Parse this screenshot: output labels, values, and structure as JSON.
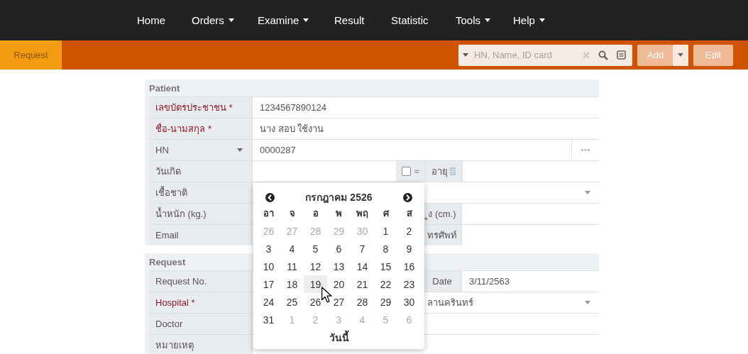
{
  "navbar": {
    "items": [
      {
        "label": "Home",
        "dropdown": false
      },
      {
        "label": "Orders",
        "dropdown": true
      },
      {
        "label": "Examine",
        "dropdown": true
      },
      {
        "label": "Result",
        "dropdown": false
      },
      {
        "label": "Statistic",
        "dropdown": false
      },
      {
        "label": "Tools",
        "dropdown": true
      },
      {
        "label": "Help",
        "dropdown": true
      }
    ]
  },
  "toolbar": {
    "tab": {
      "label": "Request",
      "selected": true
    },
    "search": {
      "placeholder": "HN, Name, ID card"
    },
    "buttons": [
      {
        "label": "Add",
        "split": true
      },
      {
        "label": "Edit",
        "split": false
      }
    ]
  },
  "sections": [
    {
      "title": "Patient",
      "rows": [
        {
          "kind": "text",
          "label": "เลขบัตรประชาชน *",
          "required": true,
          "value": "1234567890124"
        },
        {
          "kind": "text",
          "label": "ชื่อ-นามสกุล *",
          "required": true,
          "value": "นาง สอบ ใช้งาน"
        },
        {
          "kind": "select_label",
          "label": "HN",
          "required": false,
          "value": "0000287"
        },
        {
          "kind": "birth",
          "label": "วันเกิด",
          "required": false,
          "checked": false,
          "approx": "≈",
          "side_label": "อายุ"
        },
        {
          "kind": "select",
          "label": "เชื้อชาติ",
          "required": false
        },
        {
          "kind": "pair",
          "label": "น้ำหนัก (kg.)",
          "required": false,
          "side_label": "ูง (cm.)"
        },
        {
          "kind": "pair",
          "label": "Email",
          "required": false,
          "side_label": "ทรศัพท์"
        }
      ]
    },
    {
      "title": "Request",
      "rows": [
        {
          "kind": "date_pair",
          "label": "Request No.",
          "required": false,
          "side_label": "Date",
          "side_value": "3/11/2563"
        },
        {
          "kind": "select",
          "label": "Hospital *",
          "required": true,
          "value": "ลานครินทร์"
        },
        {
          "kind": "text",
          "label": "Doctor",
          "required": false
        },
        {
          "kind": "text",
          "label": "หมายเหตุ",
          "required": false
        }
      ]
    }
  ],
  "datepicker": {
    "title": "กรกฎาคม 2526",
    "weekdays": [
      "อา",
      "จ",
      "อ",
      "พ",
      "พฤ",
      "ศ",
      "ส"
    ],
    "weeks": [
      [
        {
          "day": "26",
          "other_month": true,
          "highlighted": false
        },
        {
          "day": "27",
          "other_month": true,
          "highlighted": false
        },
        {
          "day": "28",
          "other_month": true,
          "highlighted": false
        },
        {
          "day": "29",
          "other_month": true,
          "highlighted": false
        },
        {
          "day": "30",
          "other_month": true,
          "highlighted": false
        },
        {
          "day": "1",
          "other_month": false,
          "highlighted": false
        },
        {
          "day": "2",
          "other_month": false,
          "highlighted": false
        }
      ],
      [
        {
          "day": "3",
          "other_month": false,
          "highlighted": false
        },
        {
          "day": "4",
          "other_month": false,
          "highlighted": false
        },
        {
          "day": "5",
          "other_month": false,
          "highlighted": false
        },
        {
          "day": "6",
          "other_month": false,
          "highlighted": false
        },
        {
          "day": "7",
          "other_month": false,
          "highlighted": false
        },
        {
          "day": "8",
          "other_month": false,
          "highlighted": false
        },
        {
          "day": "9",
          "other_month": false,
          "highlighted": false
        }
      ],
      [
        {
          "day": "10",
          "other_month": false,
          "highlighted": false
        },
        {
          "day": "11",
          "other_month": false,
          "highlighted": false
        },
        {
          "day": "12",
          "other_month": false,
          "highlighted": false
        },
        {
          "day": "13",
          "other_month": false,
          "highlighted": false
        },
        {
          "day": "14",
          "other_month": false,
          "highlighted": false
        },
        {
          "day": "15",
          "other_month": false,
          "highlighted": false
        },
        {
          "day": "16",
          "other_month": false,
          "highlighted": false
        }
      ],
      [
        {
          "day": "17",
          "other_month": false,
          "highlighted": false
        },
        {
          "day": "18",
          "other_month": false,
          "highlighted": false
        },
        {
          "day": "19",
          "other_month": false,
          "highlighted": true
        },
        {
          "day": "20",
          "other_month": false,
          "highlighted": false
        },
        {
          "day": "21",
          "other_month": false,
          "highlighted": false
        },
        {
          "day": "22",
          "other_month": false,
          "highlighted": false
        },
        {
          "day": "23",
          "other_month": false,
          "highlighted": false
        }
      ],
      [
        {
          "day": "24",
          "other_month": false,
          "highlighted": false
        },
        {
          "day": "25",
          "other_month": false,
          "highlighted": false
        },
        {
          "day": "26",
          "other_month": false,
          "highlighted": false
        },
        {
          "day": "27",
          "other_month": false,
          "highlighted": false
        },
        {
          "day": "28",
          "other_month": false,
          "highlighted": false
        },
        {
          "day": "29",
          "other_month": false,
          "highlighted": false
        },
        {
          "day": "30",
          "other_month": false,
          "highlighted": false
        }
      ],
      [
        {
          "day": "31",
          "other_month": false,
          "highlighted": false
        },
        {
          "day": "1",
          "other_month": true,
          "highlighted": false
        },
        {
          "day": "2",
          "other_month": true,
          "highlighted": false
        },
        {
          "day": "3",
          "other_month": true,
          "highlighted": false
        },
        {
          "day": "4",
          "other_month": true,
          "highlighted": false
        },
        {
          "day": "5",
          "other_month": true,
          "highlighted": false
        },
        {
          "day": "6",
          "other_month": true,
          "highlighted": false
        }
      ]
    ],
    "today": "วันนี้"
  }
}
